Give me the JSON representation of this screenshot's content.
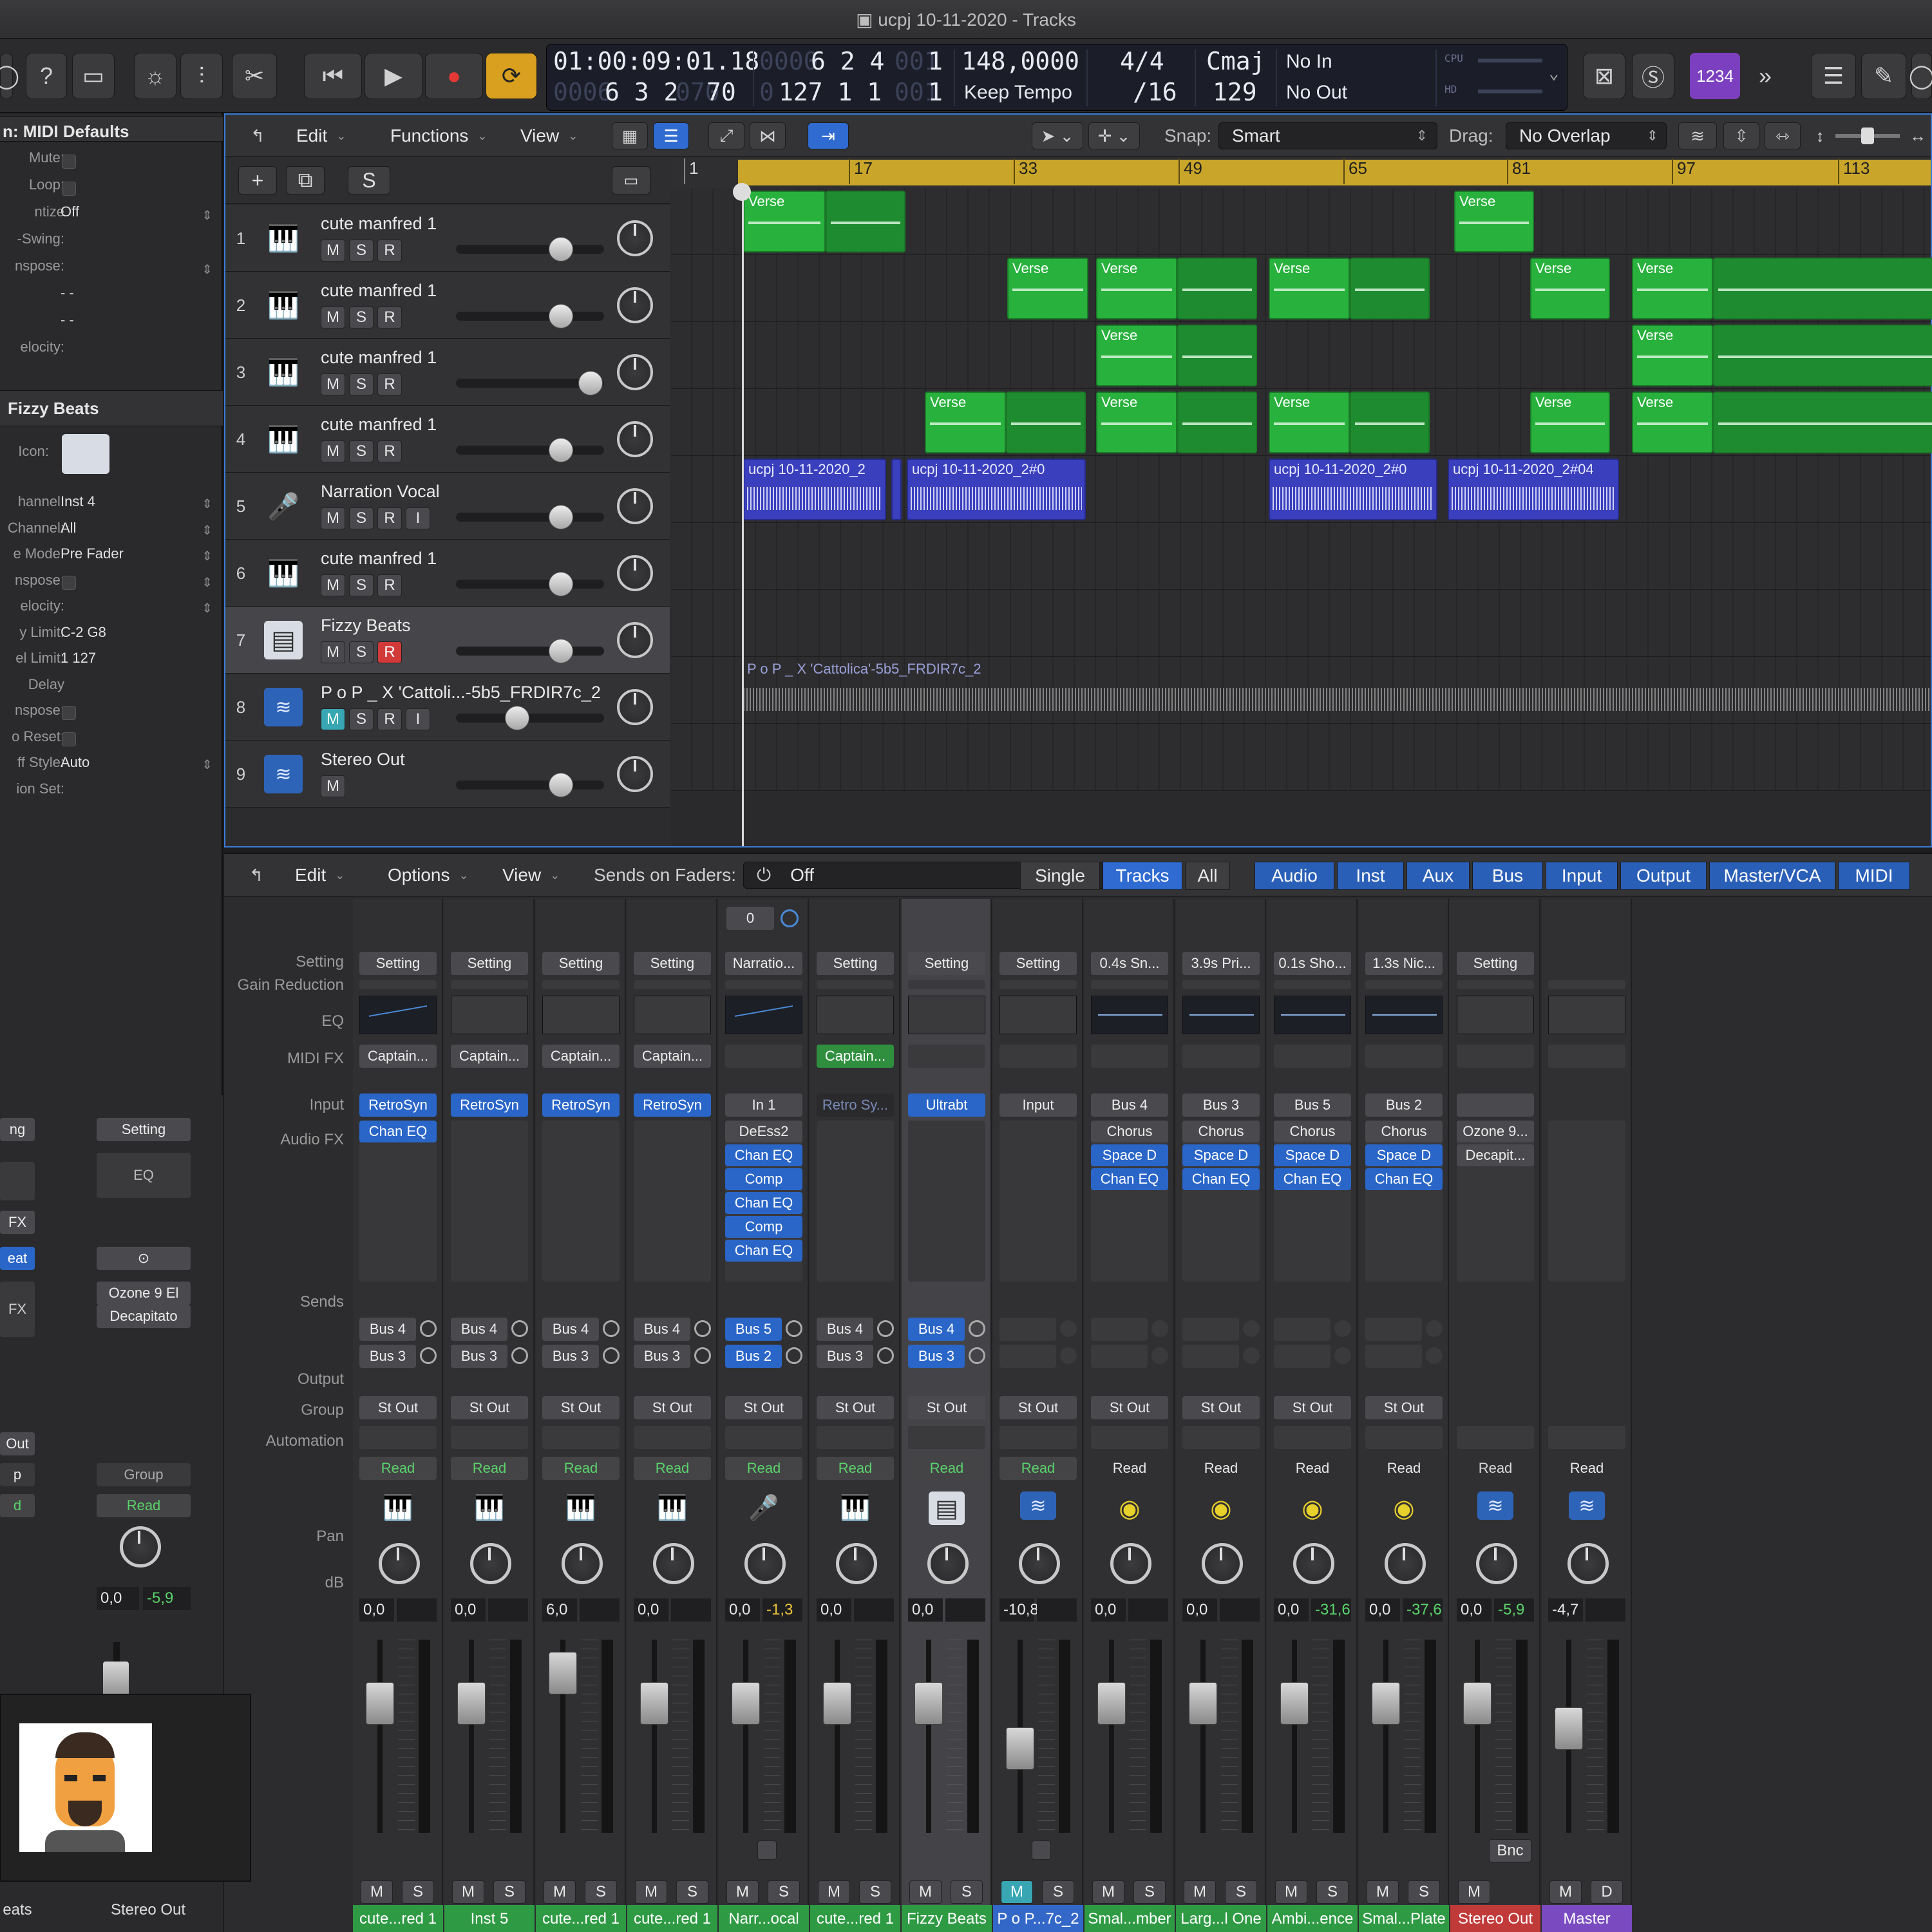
{
  "window": {
    "title": "ucpj 10-11-2020 - Tracks"
  },
  "lcd": {
    "time_main": "01:00:09:01.18",
    "time_sub_dim": "0006",
    "time_sub": "6 3 2",
    "time_sub_dim2": "070",
    "bars_dim": "0000",
    "bars": "6 2 4",
    "bars_dim2": "001",
    "bars_tick": "1",
    "end_dim": "0",
    "end": "127 1 1",
    "end_dim2": "001",
    "end_tick": "1",
    "tempo": "148,0000",
    "tempo_mode": "Keep Tempo",
    "sig_top": "4/4",
    "sig_bottom": "/16",
    "key": "Cmaj",
    "key_num": "129",
    "midi_in": "No In",
    "midi_out": "No Out",
    "cpu_label": "CPU",
    "hd_label": "HD"
  },
  "controlbar": {
    "badge": "1234"
  },
  "inspector": {
    "title": "n: MIDI Defaults",
    "rows": [
      {
        "label": "Mute:",
        "value": ""
      },
      {
        "label": "Loop:",
        "value": ""
      },
      {
        "label": "ntize",
        "value": "Off"
      },
      {
        "label": "-Swing:",
        "value": ""
      },
      {
        "label": "nspose:",
        "value": ""
      },
      {
        "label": "",
        "value": "- -"
      },
      {
        "label": "",
        "value": "- -"
      },
      {
        "label": "elocity:",
        "value": ""
      }
    ],
    "section2_title": "Fizzy Beats",
    "icon_label": "Icon:",
    "rows2": [
      {
        "label": "hannel:",
        "value": "Inst 4"
      },
      {
        "label": "Channel:",
        "value": "All"
      },
      {
        "label": "e Mode:",
        "value": "Pre Fader"
      },
      {
        "label": "nspose:",
        "value": ""
      },
      {
        "label": "elocity:",
        "value": ""
      },
      {
        "label": "y Limit:",
        "value": "C-2  G8"
      },
      {
        "label": "el Limit:",
        "value": "1  127"
      },
      {
        "label": "Delay",
        "value": ""
      },
      {
        "label": "nspose:",
        "value": ""
      },
      {
        "label": "o Reset:",
        "value": ""
      },
      {
        "label": "ff Style:",
        "value": "Auto"
      },
      {
        "label": "ion Set:",
        "value": ""
      }
    ]
  },
  "tracks_toolbar": {
    "edit": "Edit",
    "functions": "Functions",
    "view": "View",
    "snap_label": "Snap:",
    "snap_value": "Smart",
    "drag_label": "Drag:",
    "drag_value": "No Overlap"
  },
  "track_header": {
    "s_label": "S"
  },
  "ruler": {
    "bars": [
      "1",
      "17",
      "33",
      "49",
      "65",
      "81",
      "97",
      "113"
    ]
  },
  "tracks": [
    {
      "num": "1",
      "name": "cute manfred 1",
      "icon": "synth-keyboard-icon",
      "buttons": [
        "M",
        "S",
        "R"
      ]
    },
    {
      "num": "2",
      "name": "cute manfred 1",
      "icon": "synth-keyboard-icon",
      "buttons": [
        "M",
        "S",
        "R"
      ]
    },
    {
      "num": "3",
      "name": "cute manfred 1",
      "icon": "synth-keyboard-icon",
      "buttons": [
        "M",
        "S",
        "R"
      ]
    },
    {
      "num": "4",
      "name": "cute manfred 1",
      "icon": "synth-keyboard-icon",
      "buttons": [
        "M",
        "S",
        "R"
      ]
    },
    {
      "num": "5",
      "name": "Narration Vocal",
      "icon": "microphone-icon",
      "buttons": [
        "M",
        "S",
        "R",
        "I"
      ]
    },
    {
      "num": "6",
      "name": "cute manfred 1",
      "icon": "synth-keyboard-icon",
      "buttons": [
        "M",
        "S",
        "R"
      ]
    },
    {
      "num": "7",
      "name": "Fizzy Beats",
      "icon": "drum-machine-icon",
      "buttons": [
        "M",
        "S",
        "R"
      ]
    },
    {
      "num": "8",
      "name": "P o P _ X 'Cattoli...-5b5_FRDIR7c_2",
      "icon": "waveform-icon",
      "buttons": [
        "M",
        "S",
        "R",
        "I"
      ]
    },
    {
      "num": "9",
      "name": "Stereo Out",
      "icon": "waveform-icon",
      "buttons": [
        "M"
      ]
    }
  ],
  "regions": {
    "verse": "Verse",
    "audio1": "ucpj 10-11-2020_2",
    "audio2": "ucpj 10-11-2020_2#0",
    "audio3": "ucpj 10-11-2020_2#0",
    "audio4": "ucpj 10-11-2020_2#04",
    "long_audio": "P o P _ X 'Cattolica'-5b5_FRDIR7c_2"
  },
  "mixer_toolbar": {
    "edit": "Edit",
    "options": "Options",
    "view": "View",
    "sends_label": "Sends on Faders:",
    "sends_value": "Off",
    "modes": [
      "Single",
      "Tracks",
      "All"
    ],
    "filters": [
      "Audio",
      "Inst",
      "Aux",
      "Bus",
      "Input",
      "Output",
      "Master/VCA",
      "MIDI"
    ]
  },
  "mixer_rows": {
    "setting": "Setting",
    "gain_reduction": "Gain Reduction",
    "eq": "EQ",
    "midi_fx": "MIDI FX",
    "input": "Input",
    "audio_fx": "Audio FX",
    "sends": "Sends",
    "output": "Output",
    "group": "Group",
    "automation": "Automation",
    "pan": "Pan",
    "db": "dB"
  },
  "strips": [
    {
      "setting": "Setting",
      "midifx": "Captain...",
      "input": "RetroSyn",
      "fx": [
        "Chan EQ"
      ],
      "sends": [
        "Bus 4",
        "Bus 3"
      ],
      "output": "St Out",
      "auto": "Read",
      "db": "0,0",
      "peak": "",
      "name": "cute...red 1",
      "name_color": "#2f9a44",
      "icon": "synth-keyboard-icon",
      "fader": 0.72,
      "mute_on": false,
      "buttons": [
        "M",
        "S"
      ]
    },
    {
      "setting": "Setting",
      "midifx": "Captain...",
      "input": "RetroSyn",
      "fx": [],
      "sends": [
        "Bus 4",
        "Bus 3"
      ],
      "output": "St Out",
      "auto": "Read",
      "db": "0,0",
      "peak": "",
      "name": "Inst 5",
      "name_color": "#2f9a44",
      "icon": "synth-keyboard-icon",
      "fader": 0.72,
      "mute_on": false,
      "buttons": [
        "M",
        "S"
      ]
    },
    {
      "setting": "Setting",
      "midifx": "Captain...",
      "input": "RetroSyn",
      "fx": [],
      "sends": [
        "Bus 4",
        "Bus 3"
      ],
      "output": "St Out",
      "auto": "Read",
      "db": "6,0",
      "peak": "",
      "name": "cute...red 1",
      "name_color": "#2f9a44",
      "icon": "synth-keyboard-icon",
      "fader": 0.92,
      "mute_on": false,
      "buttons": [
        "M",
        "S"
      ]
    },
    {
      "setting": "Setting",
      "midifx": "Captain...",
      "input": "RetroSyn",
      "fx": [],
      "sends": [
        "Bus 4",
        "Bus 3"
      ],
      "output": "St Out",
      "auto": "Read",
      "db": "0,0",
      "peak": "",
      "name": "cute...red 1",
      "name_color": "#2f9a44",
      "icon": "synth-keyboard-icon",
      "fader": 0.72,
      "mute_on": false,
      "buttons": [
        "M",
        "S"
      ]
    },
    {
      "setting": "Narratio...",
      "midifx": "",
      "input": "In 1",
      "fx": [
        "DeEss2",
        "Chan EQ",
        "Comp",
        "Chan EQ",
        "Comp",
        "Chan EQ"
      ],
      "sends": [
        "Bus 5",
        "Bus 2"
      ],
      "output": "St Out",
      "auto": "Read",
      "db": "0,0",
      "peak": "-1,3",
      "name": "Narr...ocal",
      "name_color": "#2f9a44",
      "icon": "microphone-icon",
      "fader": 0.72,
      "mute_on": false,
      "buttons": [
        "M",
        "S"
      ],
      "top_value": "0"
    },
    {
      "setting": "Setting",
      "midifx": "Captain...",
      "input": "Retro Sy...",
      "fx": [],
      "sends": [
        "Bus 4",
        "Bus 3"
      ],
      "output": "St Out",
      "auto": "Read",
      "db": "0,0",
      "peak": "",
      "name": "cute...red 1",
      "name_color": "#2f9a44",
      "icon": "synth-keyboard-icon",
      "fader": 0.72,
      "mute_on": false,
      "buttons": [
        "M",
        "S"
      ]
    },
    {
      "setting": "Setting",
      "midifx": "",
      "input": "Ultrabt",
      "fx": [],
      "sends": [
        "Bus 4",
        "Bus 3"
      ],
      "output": "St Out",
      "auto": "Read",
      "db": "0,0",
      "peak": "",
      "name": "Fizzy Beats",
      "name_color": "#2f9a44",
      "icon": "drum-machine-icon",
      "fader": 0.72,
      "mute_on": false,
      "buttons": [
        "M",
        "S"
      ]
    },
    {
      "setting": "Setting",
      "midifx": "",
      "input": "Input",
      "fx": [],
      "sends": [],
      "output": "St Out",
      "auto": "Read",
      "db": "-10,8",
      "peak": "",
      "name": "P o P...7c_2",
      "name_color": "#3468c8",
      "icon": "waveform-icon",
      "fader": 0.42,
      "mute_on": true,
      "buttons": [
        "M",
        "S"
      ]
    },
    {
      "setting": "0.4s Sn...",
      "midifx": "",
      "input": "Bus 4",
      "fx": [
        "Chorus",
        "Space D",
        "Chan EQ"
      ],
      "sends": [],
      "output": "St Out",
      "auto": "Read",
      "db": "0,0",
      "peak": "",
      "name": "Smal...mber",
      "name_color": "#2f9a44",
      "icon": "aux-knob-icon",
      "fader": 0.72,
      "mute_on": false,
      "buttons": [
        "M",
        "S"
      ]
    },
    {
      "setting": "3.9s Pri...",
      "midifx": "",
      "input": "Bus 3",
      "fx": [
        "Chorus",
        "Space D",
        "Chan EQ"
      ],
      "sends": [],
      "output": "St Out",
      "auto": "Read",
      "db": "0,0",
      "peak": "",
      "name": "Larg...l One",
      "name_color": "#2f9a44",
      "icon": "aux-knob-icon",
      "fader": 0.72,
      "mute_on": false,
      "buttons": [
        "M",
        "S"
      ]
    },
    {
      "setting": "0.1s Sho...",
      "midifx": "",
      "input": "Bus 5",
      "fx": [
        "Chorus",
        "Space D",
        "Chan EQ"
      ],
      "sends": [],
      "output": "St Out",
      "auto": "Read",
      "db": "0,0",
      "peak": "-31,6",
      "name": "Ambi...ence",
      "name_color": "#2f9a44",
      "icon": "aux-knob-icon",
      "fader": 0.72,
      "mute_on": false,
      "buttons": [
        "M",
        "S"
      ]
    },
    {
      "setting": "1.3s Nic...",
      "midifx": "",
      "input": "Bus 2",
      "fx": [
        "Chorus",
        "Space D",
        "Chan EQ"
      ],
      "sends": [],
      "output": "St Out",
      "auto": "Read",
      "db": "0,0",
      "peak": "-37,6",
      "name": "Smal...Plate",
      "name_color": "#2f9a44",
      "icon": "aux-knob-icon",
      "fader": 0.72,
      "mute_on": false,
      "buttons": [
        "M",
        "S"
      ]
    },
    {
      "setting": "Setting",
      "midifx": "",
      "input": "",
      "fx": [
        "Ozone 9...",
        "Decapit..."
      ],
      "sends": [],
      "output": "",
      "auto": "Read",
      "db": "0,0",
      "peak": "-5,9",
      "name": "Stereo Out",
      "name_color": "#c03a3a",
      "icon": "waveform-icon",
      "fader": 0.72,
      "mute_on": false,
      "buttons": [
        "M"
      ],
      "extra": "Bnc"
    },
    {
      "setting": "",
      "midifx": "",
      "input": "",
      "fx": [],
      "sends": [],
      "output": "",
      "auto": "Read",
      "db": "-4,7",
      "peak": "",
      "name": "Master",
      "name_color": "#7a4bc0",
      "icon": "waveform-icon",
      "fader": 0.55,
      "mute_on": false,
      "buttons": [
        "M",
        "D"
      ]
    }
  ],
  "left_strips": {
    "setting_a": "ng",
    "setting_b": "Setting",
    "eq": "EQ",
    "fx_a": "FX",
    "input_a": "eat",
    "fx_b": "FX",
    "plugin1": "Ozone 9 El",
    "plugin2": "Decapitato",
    "out_a": "Out",
    "p_a": "p",
    "group_b": "Group",
    "auto_a": "d",
    "auto_b": "Read",
    "db_b": "0,0",
    "peak_b": "-5,9",
    "name_a": "eats",
    "name_b": "Stereo Out"
  }
}
